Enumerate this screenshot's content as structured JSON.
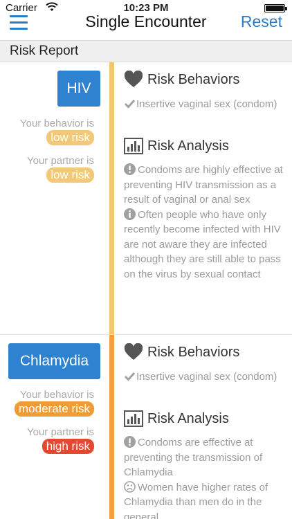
{
  "status_bar": {
    "carrier": "Carrier",
    "time": "10:23 PM"
  },
  "nav": {
    "title": "Single Encounter",
    "reset_label": "Reset"
  },
  "section_header": "Risk Report",
  "rows": [
    {
      "disease": "HIV",
      "your_behavior_label": "Your behavior is",
      "your_behavior_risk": "low risk",
      "your_partner_label": "Your partner is",
      "your_partner_risk": "low risk",
      "risk_behaviors_title": "Risk Behaviors",
      "behavior": "Insertive vaginal sex (condom)",
      "risk_analysis_title": "Risk Analysis",
      "analysis_1": "Condoms are highly effective at preventing HIV transmission as a result of vaginal or anal sex",
      "analysis_2": "Often people who have only recently become infected with HIV are not aware they are infected although they are still able to pass on the virus by sexual contact"
    },
    {
      "disease": "Chlamydia",
      "your_behavior_label": "Your behavior is",
      "your_behavior_risk": "moderate risk",
      "your_partner_label": "Your partner is",
      "your_partner_risk": "high risk",
      "risk_behaviors_title": "Risk Behaviors",
      "behavior": "Insertive vaginal sex (condom)",
      "risk_analysis_title": "Risk Analysis",
      "analysis_1": "Condoms are effective at preventing the transmission of Chlamydia",
      "analysis_2": "Women have higher rates of Chlamydia than men do in the general"
    }
  ],
  "colors": {
    "accent_blue": "#2f82cf",
    "low_risk": "#f3c879",
    "moderate_risk": "#ef9b36",
    "high_risk": "#e5472f"
  },
  "icons": [
    "menu-icon",
    "wifi-icon",
    "battery-icon",
    "heart-icon",
    "check-icon",
    "bar-chart-icon",
    "exclamation-icon",
    "info-icon",
    "sad-face-icon"
  ]
}
